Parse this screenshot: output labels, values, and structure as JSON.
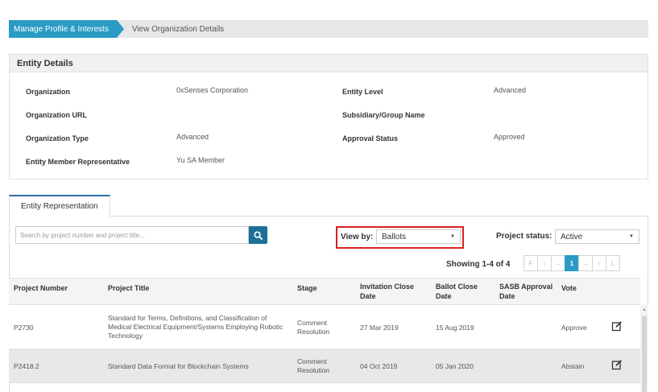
{
  "breadcrumb": {
    "active": "Manage Profile & Interests",
    "current": "View Organization Details"
  },
  "entity_details": {
    "title": "Entity Details",
    "fields": [
      {
        "label": "Organization",
        "value": "0xSenses Corporation"
      },
      {
        "label": "Entity Level",
        "value": "Advanced"
      },
      {
        "label": "Organization URL",
        "value": ""
      },
      {
        "label": "Subsidiary/Group Name",
        "value": ""
      },
      {
        "label": "Organization Type",
        "value": "Advanced"
      },
      {
        "label": "Approval Status",
        "value": "Approved"
      },
      {
        "label": "Entity Member Representative",
        "value": "Yu SA Member"
      }
    ]
  },
  "tabs": [
    {
      "label": "Entity Representation"
    }
  ],
  "search": {
    "placeholder": "Search by project number and project title..."
  },
  "filters": {
    "view_by_label": "View by:",
    "view_by_value": "Ballots",
    "project_status_label": "Project status:",
    "project_status_value": "Active"
  },
  "pagination": {
    "showing": "Showing 1-4 of 4",
    "buttons": [
      "F",
      "‹",
      "←",
      "1",
      "→",
      "›",
      "L"
    ]
  },
  "table": {
    "headers": [
      "Project Number",
      "Project Title",
      "Stage",
      "Invitation Close Date",
      "Ballot Close Date",
      "SASB Approval Date",
      "Vote"
    ],
    "rows": [
      {
        "number": "P2730",
        "title": "Standard for Terms, Definitions, and Classification of Medical Electrical Equipment/Systems Employing Robotic Technology",
        "stage": "Comment Resolution",
        "invitation_close": "27 Mar 2019",
        "ballot_close": "15 Aug 2019",
        "sasb_approval": "",
        "vote": "Approve"
      },
      {
        "number": "P2418.2",
        "title": "Standard Data Format for Blockchain Systems",
        "stage": "Comment Resolution",
        "invitation_close": "04 Oct 2019",
        "ballot_close": "05 Jan 2020",
        "sasb_approval": "",
        "vote": "Abstain"
      }
    ]
  },
  "colors": {
    "accent": "#2a9bc4",
    "search_button": "#1c6f98",
    "highlight_border": "#d62222",
    "tab_top": "#2a6fa8"
  },
  "icons": {
    "search": "search-icon",
    "edit": "edit-icon",
    "dropdown": "chevron-down-icon"
  }
}
